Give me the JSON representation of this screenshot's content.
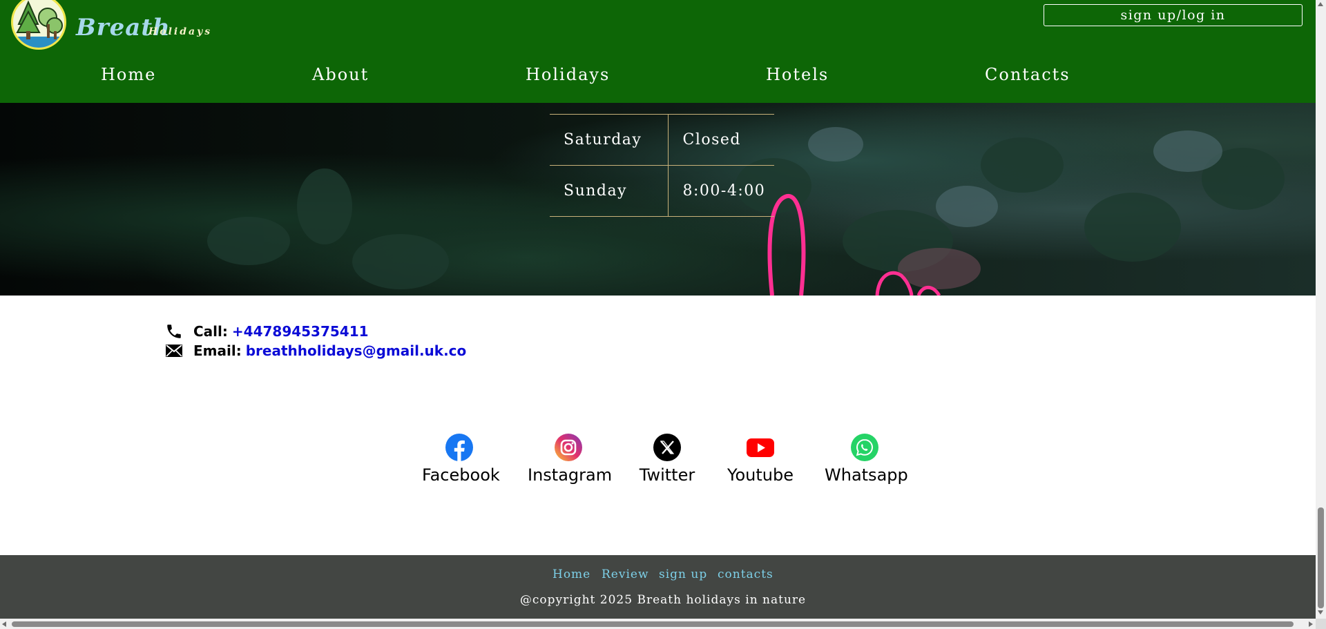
{
  "header": {
    "brand": "Breath",
    "brand_sub": "Holidays",
    "auth_label": "sign up/log in",
    "nav": [
      "Home",
      "About",
      "Holidays",
      "Hotels",
      "Contacts"
    ],
    "colors": {
      "background": "#0d6606",
      "text": "#ffffff"
    }
  },
  "opening_hours": [
    {
      "day": "Saturday",
      "time": "Closed"
    },
    {
      "day": "Sunday",
      "time": "8:00-4:00"
    }
  ],
  "contact": {
    "call_label": "Call:",
    "phone": "+4478945375411",
    "email_label": "Email:",
    "email": "breathholidays@gmail.uk.co",
    "phone_icon": "phone-icon",
    "email_icon": "envelope-icon"
  },
  "social": [
    {
      "label": "Facebook",
      "icon": "facebook-icon",
      "color": "#1877f2"
    },
    {
      "label": "Instagram",
      "icon": "instagram-icon",
      "color": "#e1306c"
    },
    {
      "label": "Twitter",
      "icon": "x-twitter-icon",
      "color": "#000000"
    },
    {
      "label": "Youtube",
      "icon": "youtube-icon",
      "color": "#ff0000"
    },
    {
      "label": "Whatsapp",
      "icon": "whatsapp-icon",
      "color": "#25d366"
    }
  ],
  "footer": {
    "links": [
      "Home",
      "Review",
      "sign up",
      "contacts"
    ],
    "copyright": "@copyright 2025 Breath holidays in nature",
    "colors": {
      "background": "#434643",
      "link": "#7dd0e8"
    }
  }
}
